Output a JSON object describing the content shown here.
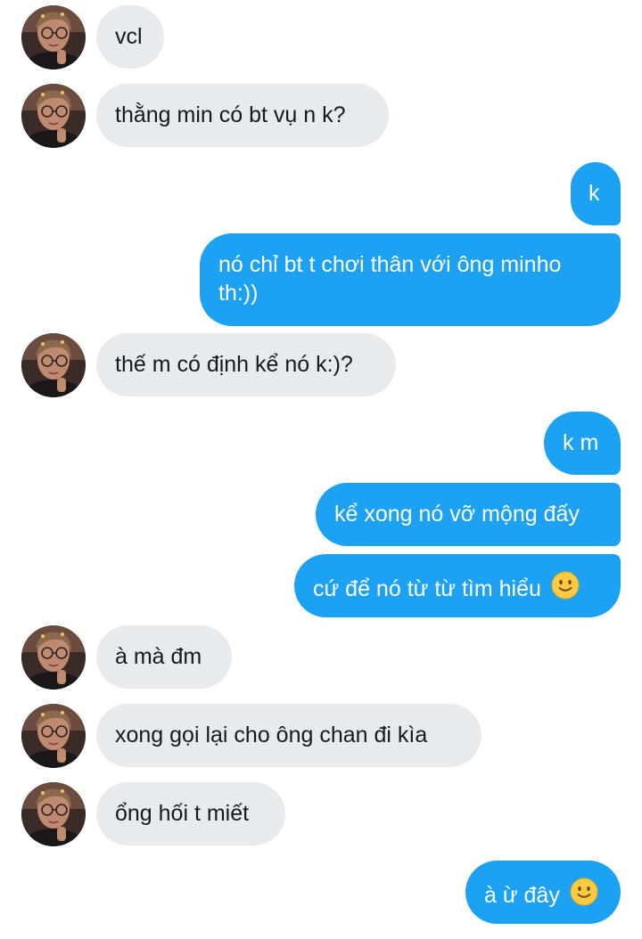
{
  "conversation": {
    "messages": [
      {
        "side": "received",
        "text": "vcl"
      },
      {
        "side": "received",
        "text": "thằng min có bt vụ n k?"
      },
      {
        "side": "sent",
        "text": "k"
      },
      {
        "side": "sent",
        "text": "nó chỉ bt t chơi thân với ông minho th:))"
      },
      {
        "side": "received",
        "text": "thế m có định kể nó k:)?"
      },
      {
        "side": "sent",
        "text": "k m"
      },
      {
        "side": "sent",
        "text": "kể xong nó vỡ mộng đấy"
      },
      {
        "side": "sent",
        "text": "cứ để nó từ từ tìm hiểu",
        "emoji": "slightly-smiling-face-icon"
      },
      {
        "side": "received",
        "text": "à mà đm"
      },
      {
        "side": "received",
        "text": "xong gọi lại cho ông chan đi kìa"
      },
      {
        "side": "received",
        "text": "ổng hối t miết"
      },
      {
        "side": "sent",
        "text": "à ừ đây",
        "emoji": "slightly-smiling-face-icon"
      }
    ]
  },
  "colors": {
    "sent_bubble": "#1da1f2",
    "received_bubble": "#e8ebee",
    "received_text": "#161a1d",
    "background": "#ffffff"
  }
}
